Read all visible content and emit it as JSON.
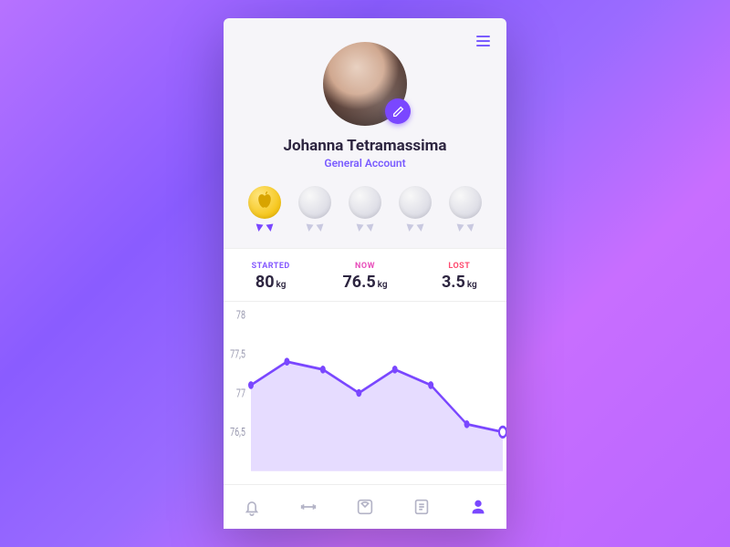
{
  "profile": {
    "name": "Johanna Tetramassima",
    "account_type": "General Account",
    "badges": [
      {
        "earned": true,
        "icon": "apple"
      },
      {
        "earned": false
      },
      {
        "earned": false
      },
      {
        "earned": false
      },
      {
        "earned": false
      }
    ]
  },
  "stats": {
    "started": {
      "label": "STARTED",
      "value": "80",
      "unit": "kg"
    },
    "now": {
      "label": "NOW",
      "value": "76.5",
      "unit": "kg"
    },
    "lost": {
      "label": "LOST",
      "value": "3.5",
      "unit": "kg"
    }
  },
  "chart_data": {
    "type": "line",
    "ylabel": "",
    "xlabel": "",
    "ylim": [
      76,
      78
    ],
    "y_ticks": [
      76.5,
      77,
      77.5,
      78
    ],
    "values": [
      77.1,
      77.4,
      77.3,
      77.0,
      77.3,
      77.1,
      76.6,
      76.5
    ],
    "color": "#7a47ff",
    "area_fill": "#e6dcff"
  },
  "nav": {
    "items": [
      "alerts",
      "workouts",
      "weight",
      "logs",
      "profile"
    ],
    "active": "profile"
  }
}
